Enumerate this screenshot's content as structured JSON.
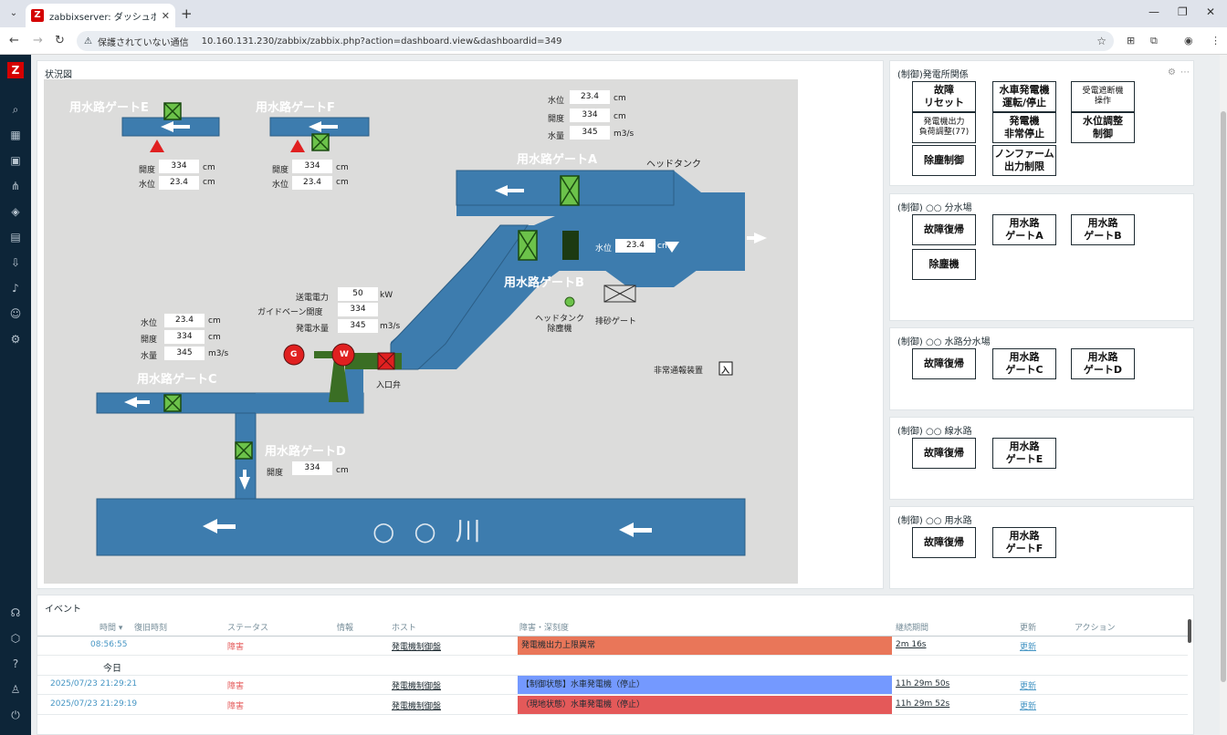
{
  "browser": {
    "tab_title": "zabbixserver: ダッシュボード",
    "security": "保護されていない通信",
    "url": "10.160.131.230/zabbix/zabbix.php?action=dashboard.view&dashboardid=349"
  },
  "sidebar": {
    "logo": "Z"
  },
  "diagram": {
    "title": "状況図",
    "gate_e": {
      "label": "用水路ゲートE",
      "opening_label": "開度",
      "opening": "334",
      "level_label": "水位",
      "level": "23.4",
      "unit": "cm"
    },
    "gate_f": {
      "label": "用水路ゲートF",
      "opening_label": "開度",
      "opening": "334",
      "level_label": "水位",
      "level": "23.4",
      "unit": "cm"
    },
    "gate_a": {
      "label": "用水路ゲートA"
    },
    "top_readings": {
      "level_label": "水位",
      "level": "23.4",
      "opening_label": "開度",
      "opening": "334",
      "flow_label": "水量",
      "flow": "345",
      "unit_cm": "cm",
      "unit_flow": "m3/s"
    },
    "head_tank": "ヘッドタンク",
    "head_tank_level_label": "水位",
    "head_tank_level": "23.4",
    "head_tank_level_unit": "cm",
    "gate_b": {
      "label": "用水路ゲートB"
    },
    "screen_label": "ヘッドタンク\n除塵機",
    "sand_gate": "排砂ゲート",
    "power": {
      "power_label": "送電電力",
      "power": "50",
      "power_unit": "kW",
      "guide_label": "ガイドベーン開度",
      "guide": "334",
      "flow_label": "発電水量",
      "flow": "345",
      "flow_unit": "m3/s"
    },
    "gate_c": {
      "label": "用水路ゲートC",
      "level_label": "水位",
      "level": "23.4",
      "opening_label": "開度",
      "opening": "334",
      "flow_label": "水量",
      "flow": "345",
      "unit_cm": "cm",
      "unit_flow": "m3/s"
    },
    "inlet_valve": "入口弁",
    "emergency": "非常通報装置",
    "emergency_state": "入",
    "gate_d": {
      "label": "用水路ゲートD",
      "opening_label": "開度",
      "opening": "334",
      "unit": "cm"
    },
    "river": "○ ○ 川",
    "generator": "G",
    "turbine": "W"
  },
  "control_panels": [
    {
      "title": "(制御)発電所関係",
      "buttons": [
        "故障\nリセット",
        "水車発電機\n運転/停止",
        "受電遮断機\n操作",
        "発電機出力\n負荷調整(77)",
        "発電機\n非常停止",
        "水位調整\n制御",
        "除塵制御",
        "ノンファーム\n出力制限"
      ]
    },
    {
      "title": "(制御) ○○ 分水場",
      "buttons": [
        "故障復帰",
        "用水路\nゲートA",
        "用水路\nゲートB",
        "除塵機"
      ]
    },
    {
      "title": "(制御) ○○ 水路分水場",
      "buttons": [
        "故障復帰",
        "用水路\nゲートC",
        "用水路\nゲートD"
      ]
    },
    {
      "title": "(制御) ○○ 線水路",
      "buttons": [
        "故障復帰",
        "用水路\nゲートE"
      ]
    },
    {
      "title": "(制御) ○○ 用水路",
      "buttons": [
        "故障復帰",
        "用水路\nゲートF"
      ]
    }
  ],
  "events": {
    "title": "イベント",
    "headers": [
      "時間 ▾",
      "復旧時刻",
      "ステータス",
      "情報",
      "ホスト",
      "障害・深刻度",
      "継続期間",
      "更新",
      "アクション"
    ],
    "today": "今日",
    "rows": [
      {
        "time": "08:56:55",
        "status": "障害",
        "host": "発電機制御盤",
        "problem": "発電機出力上限異常",
        "duration": "2m 16s",
        "update": "更新",
        "color": "#e97659"
      },
      {
        "time": "2025/07/23 21:29:21",
        "status": "障害",
        "host": "発電機制御盤",
        "problem": "【制御状態】水車発電機（停止）",
        "duration": "11h 29m 50s",
        "update": "更新",
        "color": "#7499ff"
      },
      {
        "time": "2025/07/23 21:29:19",
        "status": "障害",
        "host": "発電機制御盤",
        "problem": "（現地状態）水車発電機（停止）",
        "duration": "11h 29m 52s",
        "update": "更新",
        "color": "#e45959"
      }
    ]
  }
}
